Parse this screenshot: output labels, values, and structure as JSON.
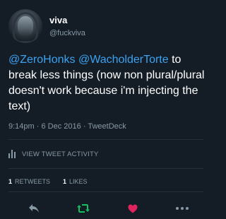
{
  "user": {
    "display_name": "viva",
    "handle": "@fuckviva"
  },
  "tweet": {
    "mention_1": "@ZeroHonks",
    "mention_2": "@WacholderTorte",
    "text": "to break less things (now non plural/plural doesn't work because i'm injecting the text)"
  },
  "meta": {
    "time": "9:14pm",
    "separator_1": "·",
    "date": "6 Dec 2016",
    "separator_2": "·",
    "client": "TweetDeck"
  },
  "activity": {
    "label": "VIEW TWEET ACTIVITY",
    "icon": "bar-chart-icon"
  },
  "stats": {
    "retweets_count": "1",
    "retweets_label": "RETWEETS",
    "likes_count": "1",
    "likes_label": "LIKES"
  },
  "actions": {
    "reply_icon": "reply-icon",
    "retweet_icon": "retweet-icon",
    "like_icon": "heart-icon",
    "more_icon": "more-icon"
  },
  "colors": {
    "background": "#141d26",
    "link": "#3ba2f2",
    "muted": "#8899a6",
    "retweet": "#17bf63",
    "like": "#e0245e"
  }
}
